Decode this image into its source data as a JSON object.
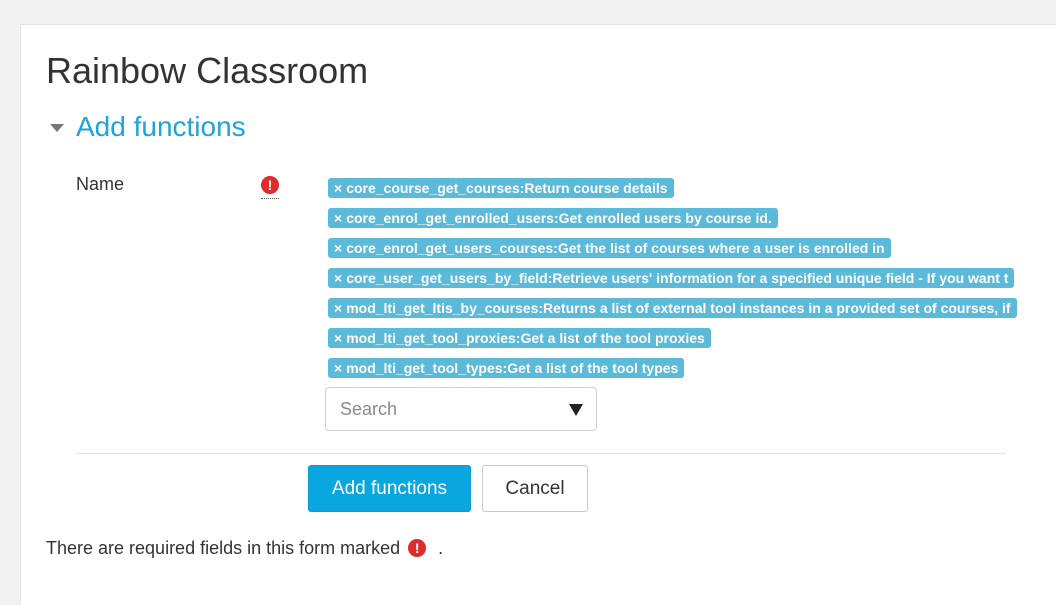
{
  "page": {
    "title": "Rainbow Classroom"
  },
  "section": {
    "title": "Add functions"
  },
  "form": {
    "name_label": "Name",
    "required_icon": "!",
    "selected_functions": [
      {
        "remove": "×",
        "label": "core_course_get_courses:Return course details"
      },
      {
        "remove": "×",
        "label": "core_enrol_get_enrolled_users:Get enrolled users by course id."
      },
      {
        "remove": "×",
        "label": "core_enrol_get_users_courses:Get the list of courses where a user is enrolled in"
      },
      {
        "remove": "×",
        "label": "core_user_get_users_by_field:Retrieve users' information for a specified unique field - If you want t"
      },
      {
        "remove": "×",
        "label": "mod_lti_get_ltis_by_courses:Returns a list of external tool instances in a provided set of courses, if"
      },
      {
        "remove": "×",
        "label": "mod_lti_get_tool_proxies:Get a list of the tool proxies"
      },
      {
        "remove": "×",
        "label": "mod_lti_get_tool_types:Get a list of the tool types"
      }
    ],
    "search": {
      "placeholder": "Search",
      "value": ""
    },
    "buttons": {
      "submit_label": "Add functions",
      "cancel_label": "Cancel"
    },
    "footer": {
      "text": "There are required fields in this form marked",
      "suffix": "."
    }
  },
  "colors": {
    "accent": "#1fa3d8",
    "tag_background": "#5bb9d9",
    "primary_button": "#0aa6df",
    "required": "#e02b2b"
  },
  "icons": {
    "section_toggle": "caret-down-icon",
    "required": "exclamation-circle-icon",
    "tag_remove": "close-icon",
    "dropdown": "dropdown-arrow-icon"
  }
}
